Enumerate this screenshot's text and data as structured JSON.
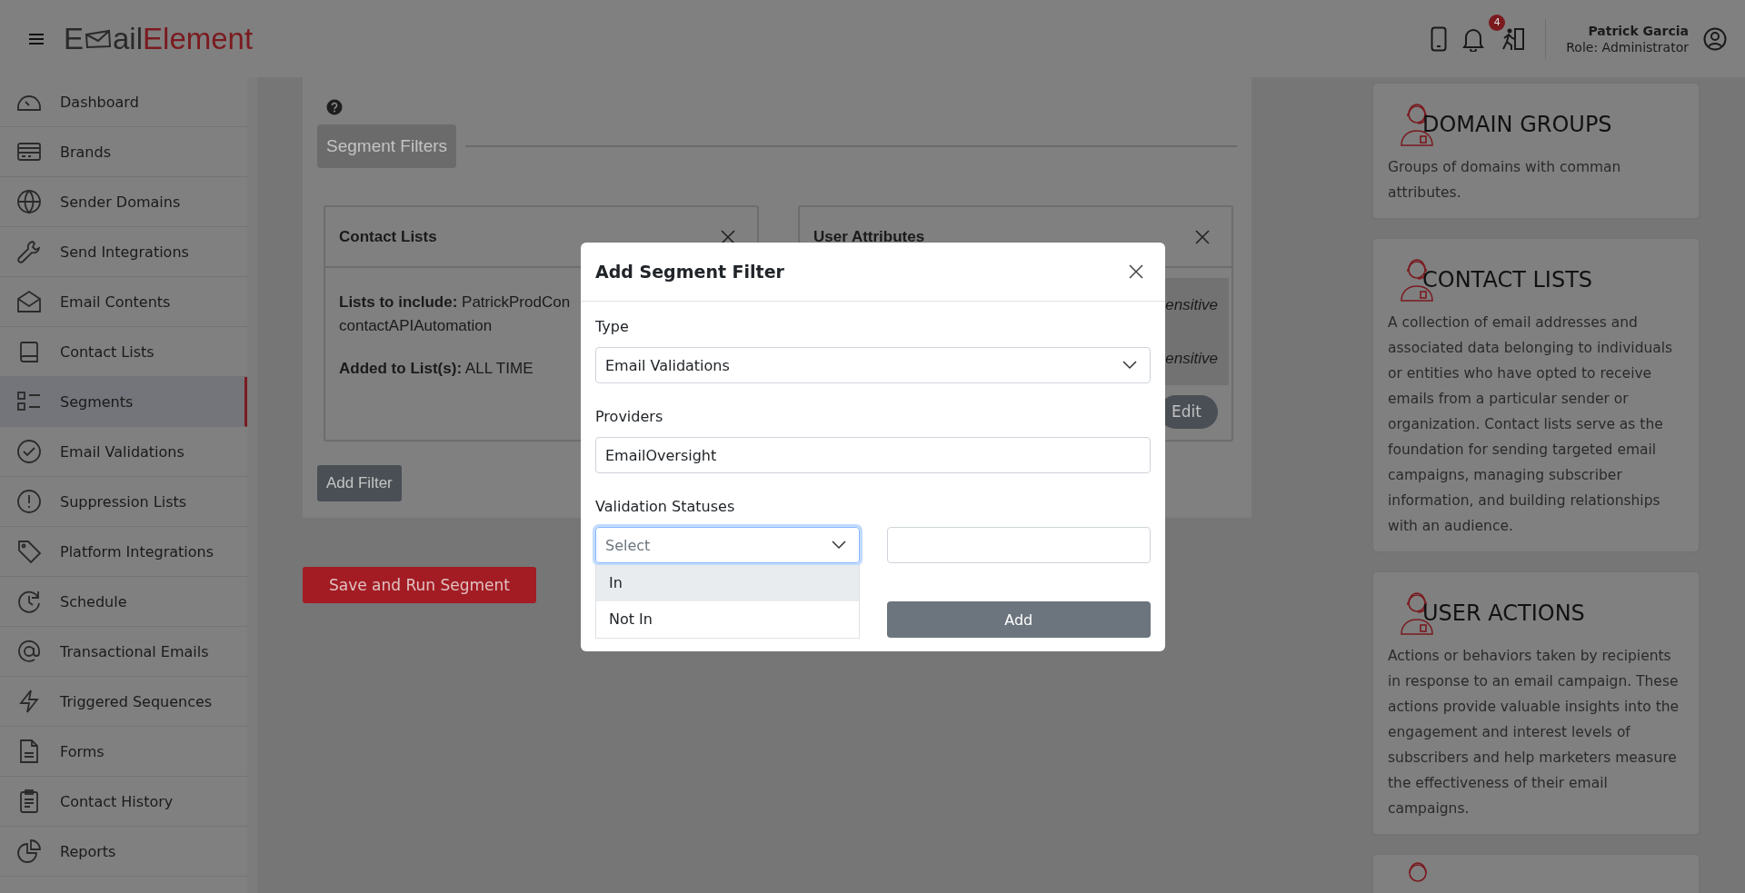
{
  "header": {
    "logo": {
      "lead": "E",
      "tail": "ail",
      "accent": "Element"
    },
    "notification_count": "4",
    "user": {
      "name": "Patrick Garcia",
      "role": "Role: Administrator"
    }
  },
  "sidebar": {
    "items": [
      {
        "label": "Dashboard",
        "selected": false
      },
      {
        "label": "Brands",
        "selected": false
      },
      {
        "label": "Sender Domains",
        "selected": false
      },
      {
        "label": "Send Integrations",
        "selected": false
      },
      {
        "label": "Email Contents",
        "selected": false
      },
      {
        "label": "Contact Lists",
        "selected": false
      },
      {
        "label": "Segments",
        "selected": true
      },
      {
        "label": "Email Validations",
        "selected": false
      },
      {
        "label": "Suppression Lists",
        "selected": false
      },
      {
        "label": "Platform Integrations",
        "selected": false
      },
      {
        "label": "Schedule",
        "selected": false
      },
      {
        "label": "Transactional Emails",
        "selected": false
      },
      {
        "label": "Triggered Sequences",
        "selected": false
      },
      {
        "label": "Forms",
        "selected": false
      },
      {
        "label": "Contact History",
        "selected": false
      },
      {
        "label": "Reports",
        "selected": false
      }
    ]
  },
  "main": {
    "section_button": "Segment Filters",
    "contact_card": {
      "title": "Contact Lists",
      "lines": [
        "**Lists to include:** PatrickProdCon",
        "contactAPIAutomation"
      ],
      "added": "**Added to List(s):**  ALL TIME"
    },
    "attributes_card": {
      "title": "User Attributes",
      "rows": [
        "ensitive",
        "ensitive"
      ],
      "edit_button": "Edit"
    },
    "add_filter_button": "Add Filter",
    "save_button": "Save and Run Segment"
  },
  "info_cards": [
    {
      "title": "DOMAIN GROUPS",
      "text": "Groups of domains with comman attributes."
    },
    {
      "title": "CONTACT LISTS",
      "text": "A collection of email addresses and associated data belonging to individuals or entities who have opted to receive emails from a particular sender or organization. Contact lists serve as the foundation for sending targeted email campaigns, managing subscriber information, and building relationships with an audience."
    },
    {
      "title": "USER ACTIONS",
      "text": "Actions or behaviors taken by recipients in response to an email campaign. These actions provide valuable insights into the engagement and interest levels of subscribers and help marketers measure the effectiveness of their email campaigns."
    }
  ],
  "modal": {
    "title": "Add Segment Filter",
    "type_label": "Type",
    "type_value": "Email Validations",
    "providers_label": "Providers",
    "providers_value": "EmailOversight",
    "statuses_label": "Validation Statuses",
    "status_placeholder": "Select",
    "options": [
      {
        "label": "In",
        "highlighted": true
      },
      {
        "label": "Not In",
        "highlighted": false
      }
    ],
    "add_button": "Add"
  }
}
